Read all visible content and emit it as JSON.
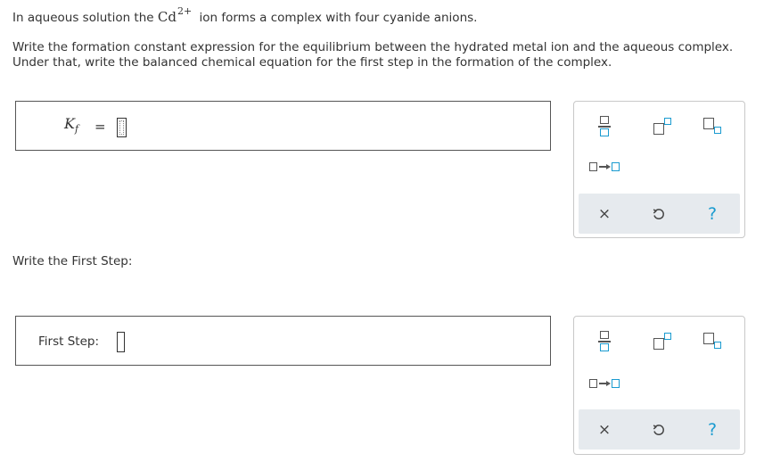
{
  "question": {
    "line1_before": "In aqueous solution the",
    "ion_symbol": "Cd",
    "ion_charge": "2+",
    "line1_after": "ion forms a complex with four cyanide anions.",
    "line2": "Write the formation constant expression for the equilibrium between the hydrated metal ion and the aqueous complex.",
    "line3": "Under that, write the balanced chemical equation for the first step in the formation of the complex."
  },
  "kf_answer": {
    "label_main": "K",
    "label_sub": "f",
    "equals": "="
  },
  "first_step_prompt": "Write the First Step:",
  "first_step_answer": {
    "label": "First Step:"
  },
  "toolbar": {
    "clear_symbol": "×",
    "help_symbol": "?"
  },
  "colors": {
    "accent": "#1a9bd0",
    "panel_bottom": "#e6eaee"
  },
  "icons": {
    "fraction": "fraction-icon",
    "superscript": "superscript-icon",
    "subscript": "subscript-icon",
    "reaction_arrow": "reaction-arrow-icon",
    "clear": "clear-x-icon",
    "undo": "undo-icon",
    "help": "help-question-icon"
  }
}
